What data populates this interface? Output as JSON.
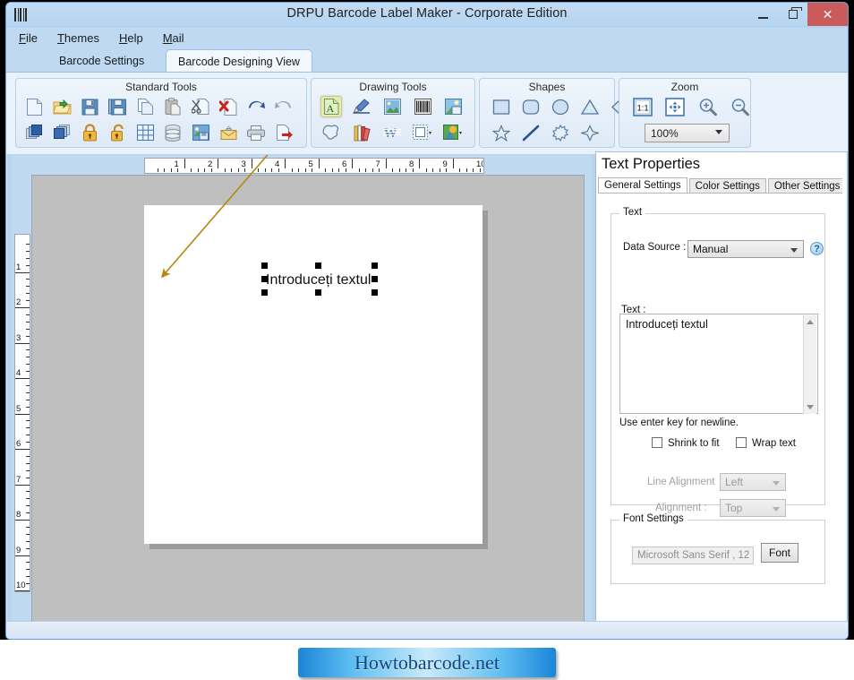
{
  "window": {
    "title": "DRPU Barcode Label Maker - Corporate Edition",
    "app_icon": "barcode-icon",
    "controls": {
      "minimize": "minimize-icon",
      "maximize": "restore-icon",
      "close": "✕"
    }
  },
  "menubar": {
    "items": [
      {
        "label": "File",
        "mnemonic": "F"
      },
      {
        "label": "Themes",
        "mnemonic": "T"
      },
      {
        "label": "Help",
        "mnemonic": "H"
      },
      {
        "label": "Mail",
        "mnemonic": "M"
      }
    ]
  },
  "main_tabs": {
    "items": [
      {
        "label": "Barcode Settings",
        "active": false
      },
      {
        "label": "Barcode Designing View",
        "active": true
      }
    ]
  },
  "ribbon": {
    "groups": [
      {
        "title": "Standard Tools",
        "buttons": [
          "new-document-icon",
          "open-folder-icon",
          "save-icon",
          "save-all-icon",
          "copy-icon",
          "paste-icon",
          "cut-icon",
          "delete-icon",
          "undo-icon",
          "redo-icon",
          "bring-to-front-icon",
          "send-to-back-icon",
          "lock-icon",
          "unlock-icon",
          "grid-icon",
          "database-icon",
          "export-image-icon",
          "email-icon",
          "print-icon",
          "exit-icon"
        ]
      },
      {
        "title": "Drawing Tools",
        "buttons": [
          "text-tool-icon",
          "signature-tool-icon",
          "picture-tool-icon",
          "barcode-tool-icon",
          "image-library-icon",
          "freehand-shape-icon",
          "library-icon",
          "watermark-icon",
          "frame-icon",
          "shape-gallery-icon"
        ],
        "active_button": "text-tool-icon"
      },
      {
        "title": "Shapes",
        "buttons": [
          "rectangle-shape-icon",
          "rounded-rectangle-shape-icon",
          "ellipse-shape-icon",
          "triangle-shape-icon",
          "diamond-shape-icon",
          "star5-shape-icon",
          "line-shape-icon",
          "burst-shape-icon",
          "star4-shape-icon",
          "pie-shape-icon"
        ]
      },
      {
        "title": "Zoom",
        "buttons": [
          "actual-size-icon",
          "fit-to-window-icon",
          "zoom-in-icon",
          "zoom-out-icon"
        ],
        "zoom_level": "100%"
      }
    ]
  },
  "designer": {
    "ruler_horizontal": {
      "ticks": [
        "1",
        "2",
        "3",
        "4",
        "5",
        "6",
        "7",
        "8",
        "9",
        "10"
      ]
    },
    "ruler_vertical": {
      "ticks": [
        "1",
        "2",
        "3",
        "4",
        "5",
        "6",
        "7",
        "8",
        "9",
        "10"
      ]
    },
    "canvas_text_object": "Introduceți textul",
    "annotation_arrow": "callout-arrow"
  },
  "properties": {
    "title": "Text Properties",
    "tabs": [
      {
        "label": "General Settings",
        "active": true
      },
      {
        "label": "Color Settings",
        "active": false
      },
      {
        "label": "Other Settings",
        "active": false
      }
    ],
    "text_group": {
      "legend": "Text",
      "data_source_label": "Data Source :",
      "data_source_value": "Manual",
      "help_glyph": "?",
      "text_label": "Text :",
      "text_value": "Introduceți textul",
      "hint": "Use enter key for newline.",
      "shrink_to_fit_label": "Shrink to fit",
      "shrink_to_fit_checked": false,
      "wrap_text_label": "Wrap text",
      "wrap_text_checked": false,
      "line_alignment_label": "Line Alignment",
      "line_alignment_value": "Left",
      "alignment_label": "Alignment :",
      "alignment_value": "Top"
    },
    "font_group": {
      "legend": "Font Settings",
      "font_value": "Microsoft Sans Serif , 12",
      "font_button_label": "Font"
    }
  },
  "banner": {
    "text": "Howtobarcode.net"
  },
  "colors": {
    "window_chrome": "#b8d4ee",
    "close_button": "#cb5a5a",
    "active_tool_highlight": "#e8eab4",
    "canvas_background": "#bfbfbf",
    "arrow": "#b8860b",
    "banner_text": "#12447e"
  }
}
